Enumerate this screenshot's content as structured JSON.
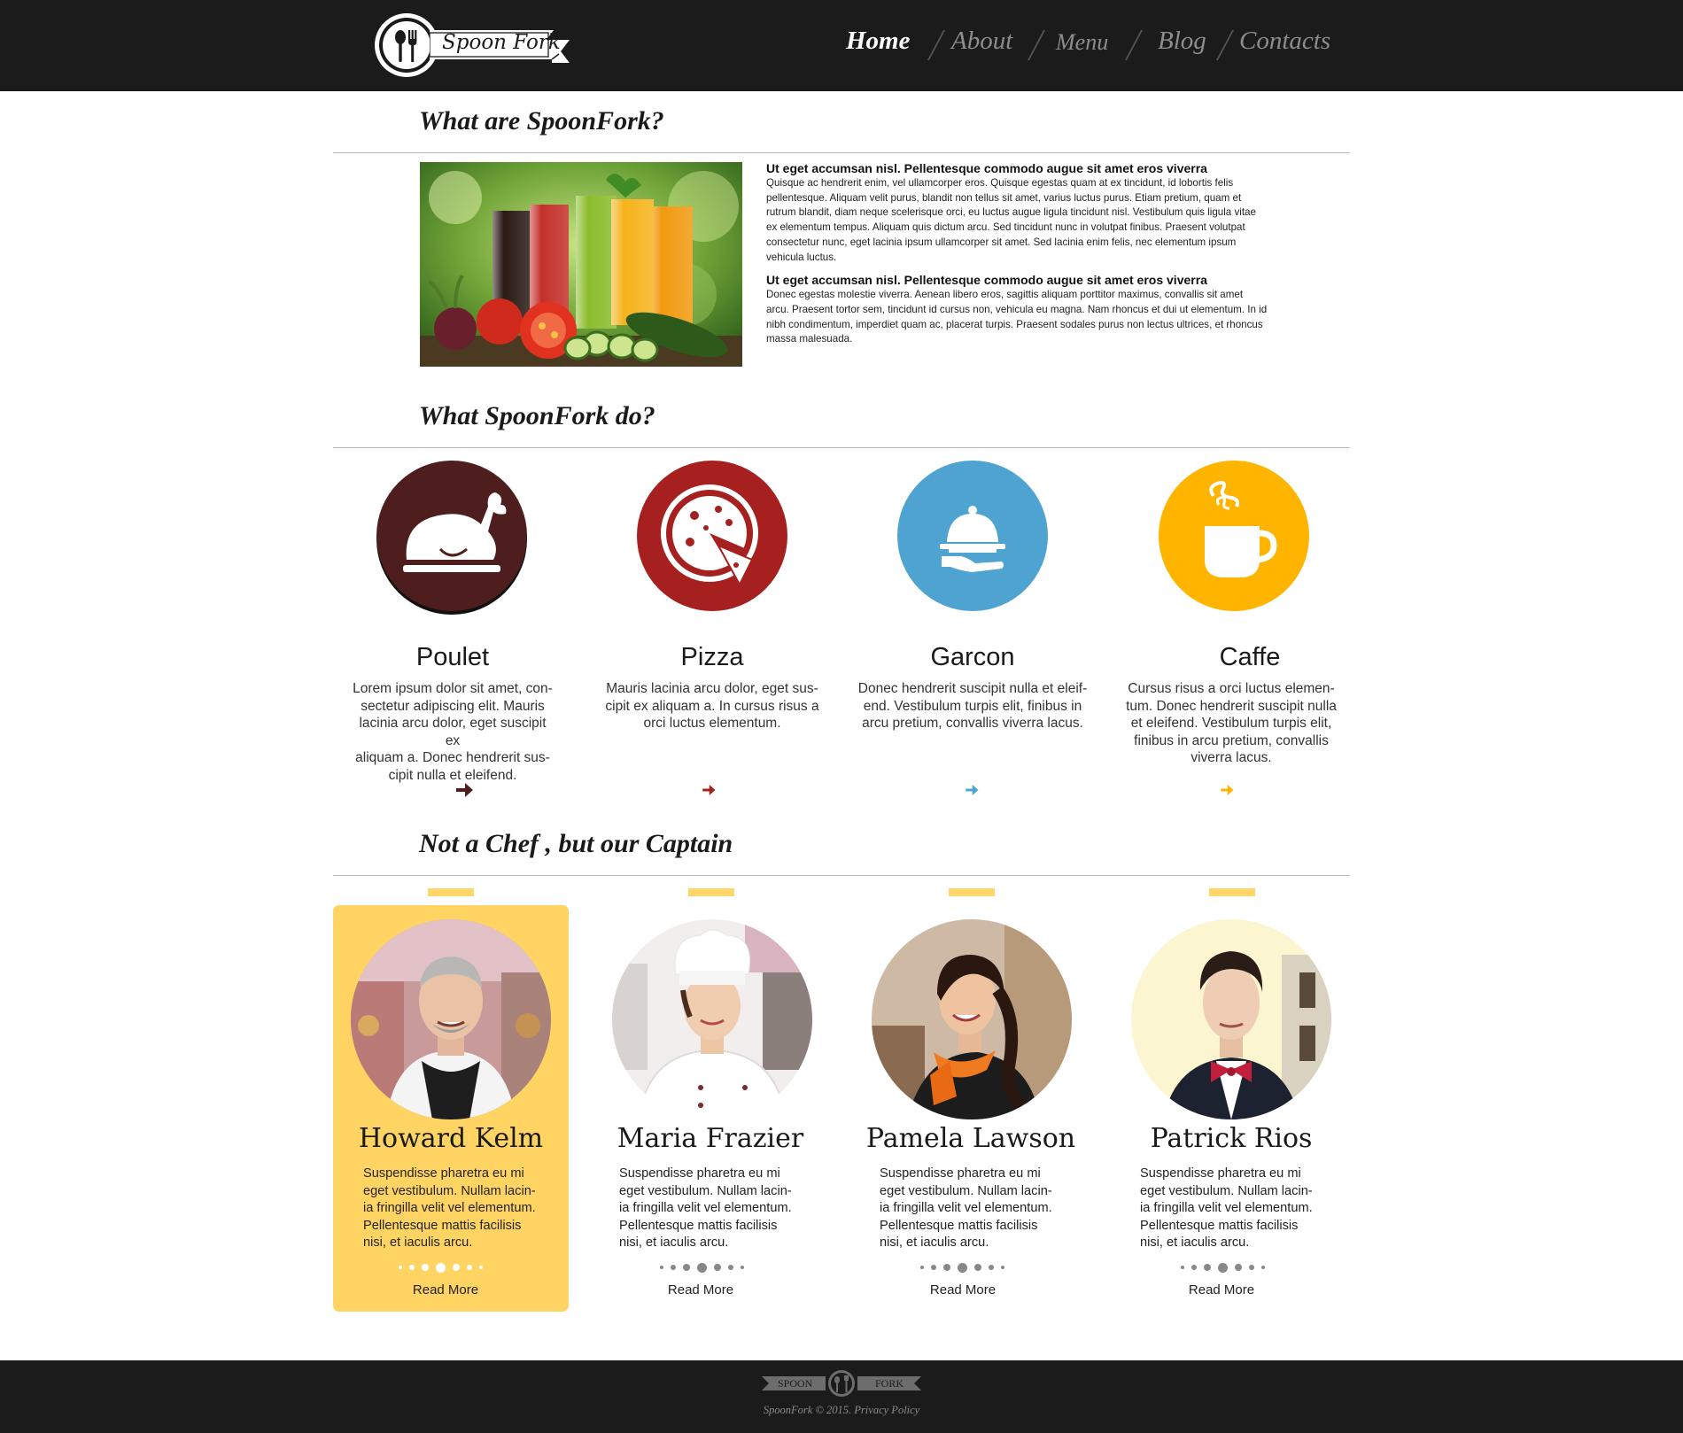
{
  "brand": {
    "name": "Spoon Fork"
  },
  "nav": [
    {
      "label": "Home",
      "active": true
    },
    {
      "label": "About",
      "active": false
    },
    {
      "label": "Menu",
      "active": false
    },
    {
      "label": "Blog",
      "active": false
    },
    {
      "label": "Contacts",
      "active": false
    }
  ],
  "about": {
    "title": "What are SpoonFork?",
    "image_icon": "juice-glasses-vegetables-photo",
    "heading1": "Ut eget accumsan nisl. Pellentesque commodo augue sit amet eros viverra",
    "para1": "Quisque ac hendrerit enim, vel ullamcorper eros. Quisque egestas quam at ex tincidunt, id lobortis felis pellentesque. Aliquam velit purus, blandit non tellus sit amet, varius luctus purus. Etiam pretium, quam et rutrum blandit, diam neque scelerisque orci, eu luctus augue ligula tincidunt nisl. Vestibulum quis ligula vitae ex elementum tempus. Aliquam quis dictum arcu. Sed tincidunt nunc in volutpat finibus. Praesent volutpat consectetur nunc, eget lacinia ipsum ullamcorper sit amet. Sed lacinia enim felis, nec elementum ipsum vehicula luctus.",
    "heading2": "Ut eget accumsan nisl. Pellentesque commodo augue sit amet eros viverra",
    "para2": "Donec egestas molestie viverra. Aenean libero eros, sagittis aliquam porttitor maximus, convallis sit amet arcu. Praesent tortor sem, tincidunt id cursus non, vehicula eu magna. Nam rhoncus et dui ut elementum. In id nibh condimentum, imperdiet quam ac, placerat turpis. Praesent sodales purus non lectus ultrices, et rhoncus massa malesuada."
  },
  "services": {
    "title": "What SpoonFork do?",
    "items": [
      {
        "title": "Poulet",
        "icon": "roast-chicken-icon",
        "color": "#4e1e1e",
        "desc": [
          "Lorem ipsum dolor sit amet, con-",
          "sectetur adipiscing elit. Mauris",
          "lacinia arcu dolor, eget suscipit ex",
          "aliquam a. Donec hendrerit sus-",
          "cipit nulla et eleifend."
        ]
      },
      {
        "title": "Pizza",
        "icon": "pizza-icon",
        "color": "#a62020",
        "desc": [
          "Mauris lacinia arcu dolor, eget sus-",
          "cipit ex aliquam a. In cursus risus a",
          "orci luctus elementum."
        ]
      },
      {
        "title": "Garcon",
        "icon": "serving-cloche-icon",
        "color": "#4fa3d1",
        "desc": [
          "Donec hendrerit suscipit nulla et eleif-",
          "end. Vestibulum turpis elit, finibus in",
          "arcu pretium, convallis viverra lacus."
        ]
      },
      {
        "title": "Caffe",
        "icon": "coffee-cup-icon",
        "color": "#ffb400",
        "desc": [
          "Cursus risus a orci luctus elemen-",
          "tum. Donec hendrerit suscipit nulla",
          "et eleifend. Vestibulum turpis elit,",
          "finibus in arcu pretium, convallis",
          "viverra lacus."
        ]
      }
    ]
  },
  "team": {
    "title": "Not a Chef , but our Captain",
    "accent": "#ffd462",
    "members": [
      {
        "name": "Howard Kelm",
        "photo": "grocer-apron-photo",
        "highlighted": true,
        "desc": [
          "Suspendisse pharetra eu mi",
          "eget vestibulum. Nullam lacin-",
          "ia fringilla velit vel elementum.",
          "Pellentesque mattis facilisis",
          "nisi, et iaculis arcu."
        ],
        "more": "Read More"
      },
      {
        "name": "Maria Frazier",
        "photo": "chef-hat-woman-photo",
        "highlighted": false,
        "desc": [
          "Suspendisse pharetra eu mi",
          "eget vestibulum. Nullam lacin-",
          "ia fringilla velit vel elementum.",
          "Pellentesque mattis facilisis",
          "nisi, et iaculis arcu."
        ],
        "more": "Read More"
      },
      {
        "name": "Pamela Lawson",
        "photo": "waitress-smiling-photo",
        "highlighted": false,
        "desc": [
          "Suspendisse pharetra eu mi",
          "eget vestibulum. Nullam lacin-",
          "ia fringilla velit vel elementum.",
          "Pellentesque mattis facilisis",
          "nisi, et iaculis arcu."
        ],
        "more": "Read More"
      },
      {
        "name": "Patrick Rios",
        "photo": "waiter-bowtie-photo",
        "highlighted": false,
        "desc": [
          "Suspendisse pharetra eu mi",
          "eget vestibulum. Nullam lacin-",
          "ia fringilla velit vel elementum.",
          "Pellentesque mattis facilisis",
          "nisi, et iaculis arcu."
        ],
        "more": "Read More"
      }
    ]
  },
  "footer": {
    "logo_left": "SPOON",
    "logo_right": "FORK",
    "copyright": "SpoonFork © 2015. Privacy Policy"
  }
}
